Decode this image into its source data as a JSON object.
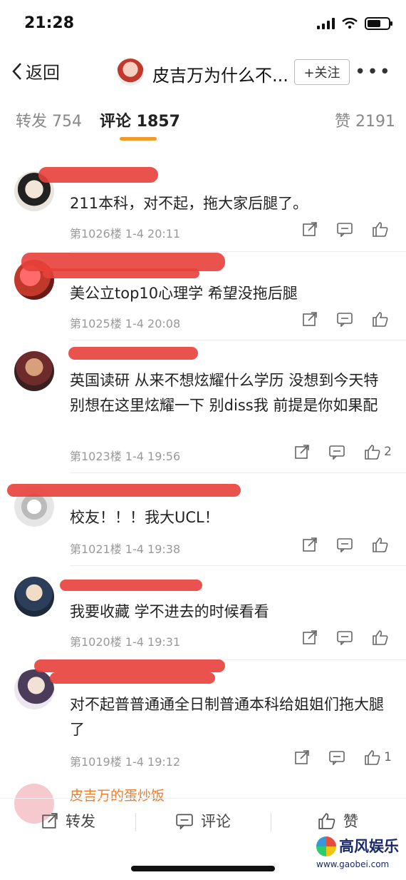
{
  "status": {
    "time": "21:28"
  },
  "nav": {
    "back_label": "返回",
    "title": "皮吉万为什么不...",
    "follow_label": "+关注",
    "more_label": "•••"
  },
  "tabs": {
    "repost": "转发 754",
    "comment": "评论 1857",
    "like": "赞 2191"
  },
  "comments": [
    {
      "name": "",
      "text": "211本科，对不起，拖大家后腿了。",
      "meta": "第1026楼 1-4 20:11",
      "likes": ""
    },
    {
      "name": "",
      "text": "美公立top10心理学 希望没拖后腿",
      "meta": "第1025楼 1-4 20:08",
      "likes": ""
    },
    {
      "name": "",
      "text": "英国读研 从来不想炫耀什么学历 没想到今天特别想在这里炫耀一下 别diss我 前提是你如果配",
      "meta": "第1023楼 1-4 19:56",
      "likes": "2"
    },
    {
      "name": "",
      "text": "校友！！！我大UCL！",
      "meta": "第1021楼 1-4 19:38",
      "likes": ""
    },
    {
      "name": "",
      "text": "我要收藏 学不进去的时候看看",
      "meta": "第1020楼 1-4 19:31",
      "likes": ""
    },
    {
      "name": "",
      "text": "对不起普普通通全日制普通本科给姐姐们拖大腿了",
      "meta": "第1019楼 1-4 19:12",
      "likes": "1"
    },
    {
      "name": "皮吉万的蛋炒饭",
      "text": "",
      "meta": "",
      "likes": ""
    }
  ],
  "bottom_bar": {
    "repost": "转发",
    "comment": "评论",
    "like": "赞"
  },
  "watermark": {
    "title": "高风娱乐",
    "url": "www.gaobei.com"
  },
  "colors": {
    "accent": "#f39b2a",
    "redaction": "#e8403a",
    "nickname_orange": "#f07c2a"
  }
}
